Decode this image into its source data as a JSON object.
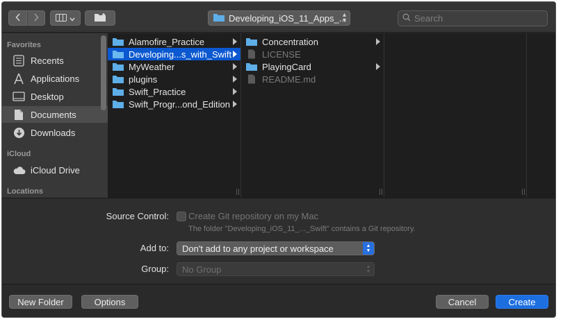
{
  "toolbar": {
    "back_icon": "chevron-left-icon",
    "forward_icon": "chevron-right-icon",
    "view_icon": "column-view-icon",
    "newfolder_icon": "folder-add-icon",
    "path_label": "Developing_iOS_11_Apps_...",
    "search_placeholder": "Search"
  },
  "sidebar": {
    "sections": [
      {
        "header": "Favorites"
      },
      {
        "header": "iCloud"
      },
      {
        "header": "Locations"
      }
    ],
    "items": [
      {
        "label": "Recents",
        "icon": "recents-icon"
      },
      {
        "label": "Applications",
        "icon": "applications-icon"
      },
      {
        "label": "Desktop",
        "icon": "desktop-icon"
      },
      {
        "label": "Documents",
        "icon": "documents-icon",
        "selected": true
      },
      {
        "label": "Downloads",
        "icon": "downloads-icon"
      },
      {
        "label": "iCloud Drive",
        "icon": "cloud-icon"
      }
    ]
  },
  "columns": [
    {
      "rows": [
        {
          "label": "Alamofire_Practice",
          "type": "folder"
        },
        {
          "label": "Developing...s_with_Swift",
          "type": "folder",
          "selected": true
        },
        {
          "label": "MyWeather",
          "type": "folder"
        },
        {
          "label": "plugins",
          "type": "folder"
        },
        {
          "label": "Swift_Practice",
          "type": "folder"
        },
        {
          "label": "Swift_Progr...ond_Edition",
          "type": "folder"
        }
      ]
    },
    {
      "rows": [
        {
          "label": "Concentration",
          "type": "folder"
        },
        {
          "label": "LICENSE",
          "type": "file"
        },
        {
          "label": "PlayingCard",
          "type": "folder"
        },
        {
          "label": "README.md",
          "type": "file"
        }
      ]
    }
  ],
  "options": {
    "source_control_label": "Source Control:",
    "git_checkbox_label": "Create Git repository on my Mac",
    "git_note": "The folder \"Developing_iOS_11_..._Swift\" contains a Git repository.",
    "add_to_label": "Add to:",
    "add_to_value": "Don't add to any project or workspace",
    "group_label": "Group:",
    "group_value": "No Group"
  },
  "footer": {
    "new_folder": "New Folder",
    "options": "Options",
    "cancel": "Cancel",
    "create": "Create"
  },
  "colors": {
    "selection": "#0b58d0",
    "primary_button": "#1d6fe0",
    "folder": "#5eaee8"
  }
}
